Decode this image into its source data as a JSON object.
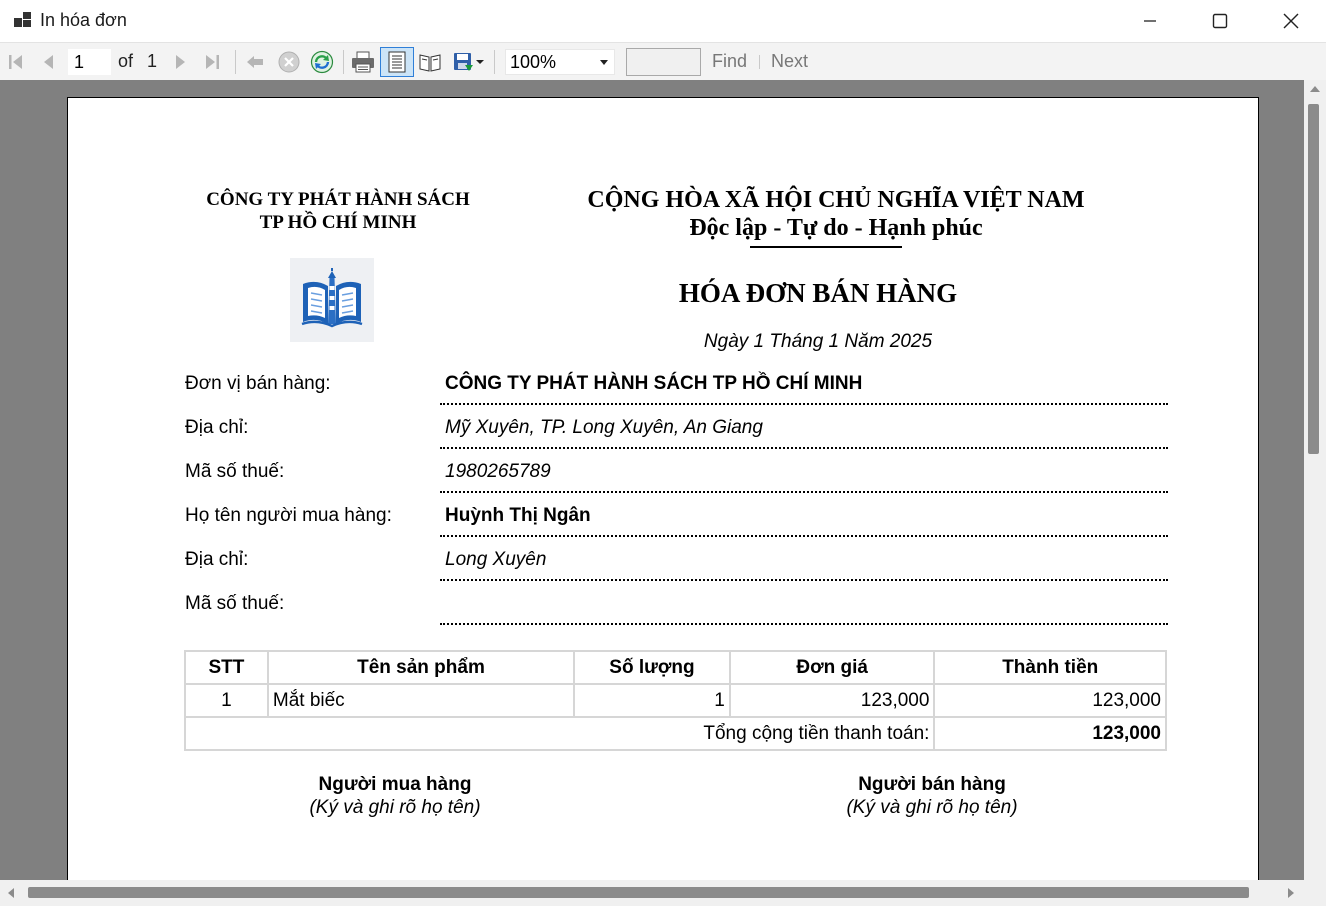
{
  "window": {
    "title": "In hóa đơn"
  },
  "toolbar": {
    "page_current": "1",
    "of_label": "of",
    "page_total": "1",
    "zoom": "100%",
    "find_label": "Find",
    "next_label": "Next",
    "find_value": ""
  },
  "report": {
    "company_line1": "CÔNG TY PHÁT HÀNH SÁCH",
    "company_line2": "TP HỒ CHÍ MINH",
    "nation_line1": "CỘNG HÒA XÃ HỘI CHỦ NGHĨA VIỆT NAM",
    "nation_line2": "Độc lập - Tự do - Hạnh phúc",
    "title": "HÓA ĐƠN BÁN HÀNG",
    "date": "Ngày 1 Tháng 1 Năm 2025",
    "fields": [
      {
        "label": "Đơn vị bán hàng:",
        "value": "CÔNG TY PHÁT HÀNH SÁCH TP HỒ CHÍ MINH"
      },
      {
        "label": "Địa chỉ:",
        "value": "Mỹ Xuyên, TP. Long Xuyên, An Giang"
      },
      {
        "label": "Mã số thuế:",
        "value": "1980265789"
      },
      {
        "label": "Họ tên người mua hàng:",
        "value": "Huỳnh Thị Ngân"
      },
      {
        "label": "Địa chỉ:",
        "value": "Long Xuyên"
      },
      {
        "label": "Mã số thuế:",
        "value": ""
      }
    ],
    "table": {
      "headers": [
        "STT",
        "Tên sản phẩm",
        "Số lượng",
        "Đơn giá",
        "Thành tiền"
      ],
      "rows": [
        [
          "1",
          "Mắt biếc",
          "1",
          "123,000",
          "123,000"
        ]
      ],
      "total_label": "Tổng cộng tiền thanh toán:",
      "total_value": "123,000"
    },
    "buyer_title": "Người mua hàng",
    "buyer_note": "(Ký và ghi rõ họ tên)",
    "seller_title": "Người bán hàng",
    "seller_note": "(Ký và ghi rõ họ tên)"
  }
}
